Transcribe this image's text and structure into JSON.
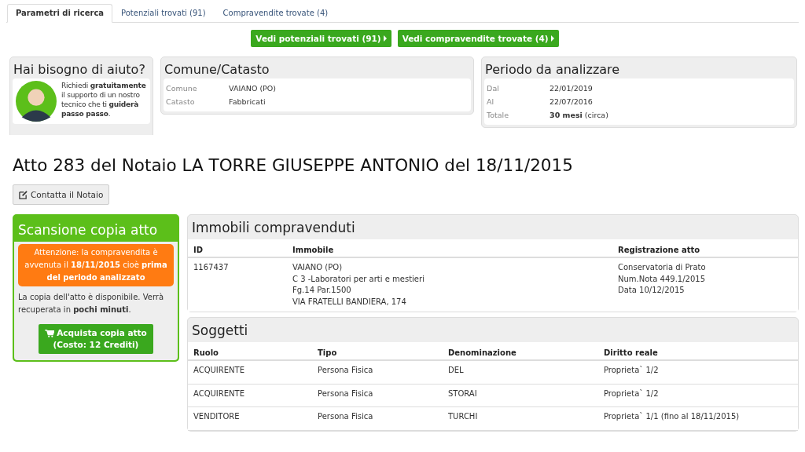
{
  "tabs": [
    {
      "label": "Parametri di ricerca",
      "selected": true
    },
    {
      "label": "Potenziali trovati (91)",
      "selected": false
    },
    {
      "label": "Compravendite trovate (4)",
      "selected": false
    }
  ],
  "action_buttons": [
    "Vedi potenziali trovati (91)",
    "Vedi compravendite trovate (4)"
  ],
  "help_card": {
    "title": "Hai bisogno di aiuto?",
    "text": "Richiedi **gratuitamente** il supporto di un nostro tecnico che ti **guiderà passo passo**."
  },
  "comune_card": {
    "title": "Comune/Catasto",
    "rows": [
      {
        "label": "Comune",
        "value": "VAIANO (PO)"
      },
      {
        "label": "Catasto",
        "value": "Fabbricati"
      }
    ]
  },
  "periodo_card": {
    "title": "Periodo da analizzare",
    "rows": [
      {
        "label": "Dal",
        "value": "22/01/2019"
      },
      {
        "label": "Al",
        "value": "22/07/2016"
      },
      {
        "label": "Totale",
        "value": "**30 mesi** (circa)"
      }
    ]
  },
  "heading": "Atto 283 del Notaio LA TORRE GIUSEPPE ANTONIO del 18/11/2015",
  "contact_button": "Contatta il Notaio",
  "scan_card": {
    "title": "Scansione copia atto",
    "warning": "Attenzione: la compravendita è avvenuta il **18/11/2015** cioè **prima del periodo analizzato**",
    "text": "La copia dell'atto è disponibile. Verrà recuperata in **pochi minuti**.",
    "button_lines": [
      "Acquista copia atto",
      "(Costo: 12 Crediti)"
    ]
  },
  "immobili": {
    "title": "Immobili compravenduti",
    "columns": [
      "ID",
      "Immobile",
      "Registrazione atto"
    ],
    "rows": [
      {
        "cells": [
          [
            "1167437"
          ],
          [
            "VAIANO (PO)",
            "C 3 -Laboratori per arti e mestieri",
            "Fg.14 Par.1500",
            "VIA FRATELLI BANDIERA, 174"
          ],
          [
            "Conservatoria di Prato",
            "Num.Nota 449.1/2015",
            "Data 10/12/2015"
          ]
        ]
      }
    ]
  },
  "soggetti": {
    "title": "Soggetti",
    "columns": [
      "Ruolo",
      "Tipo",
      "Denominazione",
      "Diritto reale"
    ],
    "rows": [
      [
        "ACQUIRENTE",
        "Persona Fisica",
        "DEL",
        "Proprieta` 1/2"
      ],
      [
        "ACQUIRENTE",
        "Persona Fisica",
        "STORAI",
        "Proprieta` 1/2"
      ],
      [
        "VENDITORE",
        "Persona Fisica",
        "TURCHI",
        "Proprieta` 1/1 (fino al 18/11/2015)"
      ]
    ]
  }
}
